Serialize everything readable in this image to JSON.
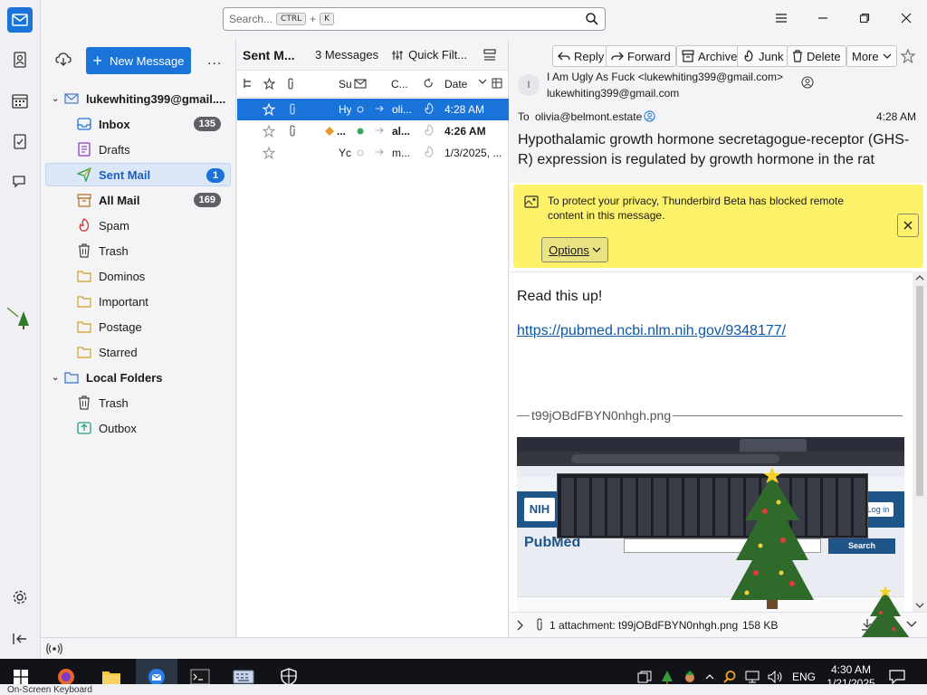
{
  "search": {
    "placeholder": "Search...",
    "key1": "CTRL",
    "plus": "+",
    "key2": "K"
  },
  "folder_pane": {
    "new_message": "New Message",
    "more": "...",
    "account": "lukewhiting399@gmail....",
    "folders": [
      {
        "label": "Inbox",
        "count": "135",
        "icon": "inbox-icon"
      },
      {
        "label": "Drafts",
        "count": "",
        "icon": "drafts-icon"
      },
      {
        "label": "Sent Mail",
        "count": "1",
        "icon": "sent-icon"
      },
      {
        "label": "All Mail",
        "count": "169",
        "icon": "archive-icon"
      },
      {
        "label": "Spam",
        "count": "",
        "icon": "spam-icon"
      },
      {
        "label": "Trash",
        "count": "",
        "icon": "trash-icon"
      },
      {
        "label": "Dominos",
        "count": "",
        "icon": "folder-icon"
      },
      {
        "label": "Important",
        "count": "",
        "icon": "folder-icon"
      },
      {
        "label": "Postage",
        "count": "",
        "icon": "folder-icon"
      },
      {
        "label": "Starred",
        "count": "",
        "icon": "folder-icon"
      }
    ],
    "local_folders": "Local Folders",
    "local": [
      {
        "label": "Trash",
        "icon": "trash-icon"
      },
      {
        "label": "Outbox",
        "icon": "outbox-icon"
      }
    ]
  },
  "message_list": {
    "folder_name": "Sent M...",
    "count": "3 Messages",
    "quick_filter": "Quick Filt...",
    "columns": {
      "subject": "Su",
      "correspondent": "C...",
      "date": "Date"
    },
    "rows": [
      {
        "subject": "Hy",
        "correspondent": "oli...",
        "date": "4:28 AM"
      },
      {
        "subject": "...",
        "correspondent": "al...",
        "date": "4:26 AM"
      },
      {
        "subject": "Yc",
        "correspondent": "m...",
        "date": "1/3/2025, ..."
      }
    ]
  },
  "reading_pane": {
    "buttons": {
      "reply": "Reply",
      "forward": "Forward",
      "archive": "Archive",
      "junk": "Junk",
      "delete": "Delete",
      "more": "More"
    },
    "avatar_initial": "I",
    "from_name": "I Am Ugly As Fuck <lukewhiting399@gmail.com>",
    "from_email": "lukewhiting399@gmail.com",
    "to_label": "To",
    "to": "olivia@belmont.estate",
    "time": "4:28 AM",
    "subject": "Hypothalamic growth hormone secretagogue-receptor (GHS-R) expression is regulated by growth hormone in the rat",
    "remote_notice": "To protect your privacy, Thunderbird Beta has blocked remote content in this message.",
    "options": "Options",
    "body_text": "Read this up!",
    "body_link": "https://pubmed.ncbi.nlm.nih.gov/9348177/",
    "image_name": "t99jOBdFBYN0nhgh.png",
    "attachment": "1 attachment: t99jOBdFBYN0nhgh.png",
    "attachment_size": "158 KB"
  },
  "embedded_screenshot": {
    "logo_nih": "NIH",
    "logo_pubmed": "PubMed",
    "search_btn": "Search",
    "login": "Log in"
  },
  "taskbar": {
    "lang": "ENG",
    "time": "4:30 AM",
    "date": "1/21/2025",
    "osk_title": "On-Screen Keyboard"
  },
  "colors": {
    "accent": "#1a73d9",
    "notice_bg": "#fdf26a"
  }
}
